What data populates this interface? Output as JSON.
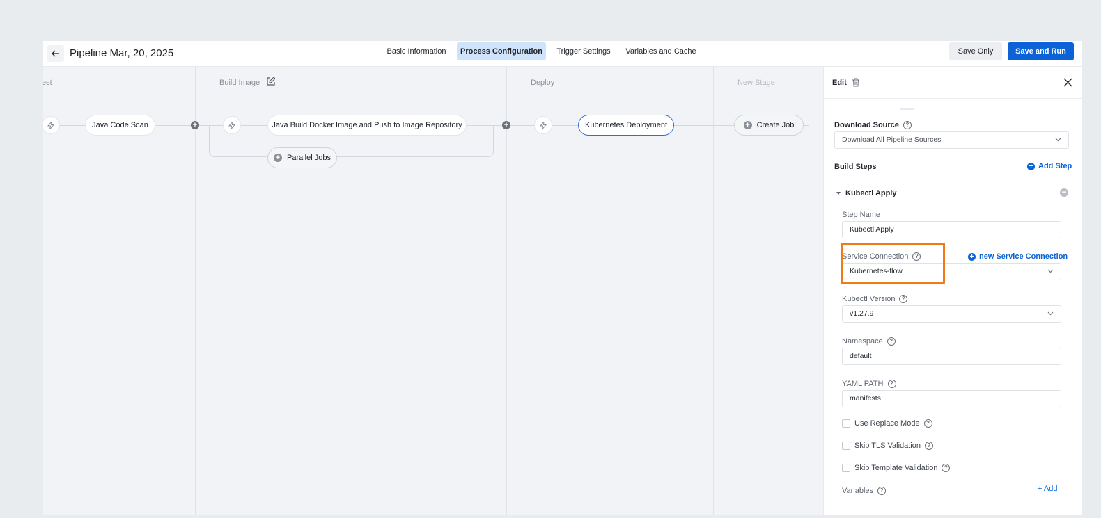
{
  "header": {
    "back_icon": "arrow-left-icon",
    "title": "Pipeline Mar, 20, 2025",
    "tabs": [
      {
        "label": "Basic Information"
      },
      {
        "label": "Process Configuration",
        "active": true
      },
      {
        "label": "Trigger Settings"
      },
      {
        "label": "Variables and Cache"
      }
    ],
    "save_only": "Save Only",
    "save_and_run": "Save and Run"
  },
  "stages": {
    "test_title_partial": "est",
    "build_title": "Build Image",
    "deploy_title": "Deploy",
    "new_stage_title": "New Stage"
  },
  "jobs": {
    "java_code_scan": "Java Code Scan",
    "docker_build": "Java Build Docker Image and Push to Image Repository",
    "parallel_jobs": "Parallel Jobs",
    "k8s_deploy": "Kubernetes Deployment",
    "create_job": "Create Job"
  },
  "panel": {
    "title": "Edit",
    "download_source": {
      "label": "Download Source",
      "value": "Download All Pipeline Sources"
    },
    "build_steps": {
      "label": "Build Steps",
      "add_step": "Add Step"
    },
    "step": {
      "name": "Kubectl Apply",
      "step_name_label": "Step Name",
      "step_name_value": "Kubectl Apply",
      "service_connection_label": "Service Connection",
      "new_service_connection": "new Service Connection",
      "service_connection_value": "Kubernetes-flow",
      "kubectl_version_label": "Kubectl Version",
      "kubectl_version_value": "v1.27.9",
      "namespace_label": "Namespace",
      "namespace_value": "default",
      "yaml_path_label": "YAML PATH",
      "yaml_path_value": "manifests",
      "use_replace_mode": "Use Replace Mode",
      "skip_tls": "Skip TLS Validation",
      "skip_template": "Skip Template Validation",
      "variables_label": "Variables",
      "add_variable": "+ Add"
    }
  },
  "colors": {
    "primary": "#0b63d7",
    "active_tab_bg": "#cfe3fb",
    "highlight": "#f07a16"
  }
}
